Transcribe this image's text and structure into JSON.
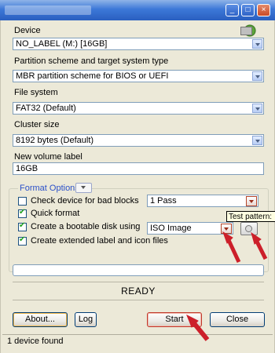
{
  "device": {
    "label": "Device",
    "value": "NO_LABEL (M:) [16GB]"
  },
  "partition": {
    "label": "Partition scheme and target system type",
    "value": "MBR partition scheme for BIOS or UEFI"
  },
  "filesystem": {
    "label": "File system",
    "value": "FAT32 (Default)"
  },
  "cluster": {
    "label": "Cluster size",
    "value": "8192 bytes (Default)"
  },
  "volume": {
    "label": "New volume label",
    "value": "16GB"
  },
  "format_options": {
    "title": "Format Options",
    "bad_blocks": {
      "label": "Check device for bad blocks",
      "checked": false,
      "passes": "1 Pass"
    },
    "quick_format": {
      "label": "Quick format",
      "checked": true
    },
    "bootable": {
      "label": "Create a bootable disk using",
      "checked": true,
      "source": "ISO Image"
    },
    "extended_label": {
      "label": "Create extended label and icon files",
      "checked": true
    }
  },
  "tooltip": "Test pattern:",
  "status": "READY",
  "buttons": {
    "about": "About...",
    "log": "Log",
    "start": "Start",
    "close": "Close"
  },
  "statusbar": "1 device found",
  "icons": [
    "device-drive-icon",
    "dropdown-icon",
    "check-icon",
    "disk-image-icon",
    "red-arrow-annotation"
  ],
  "colors": {
    "dialog_bg": "#ece9d8",
    "title_blue": "#2b50c9",
    "annotation_red": "#cc1f2a",
    "check_green": "#21a121"
  }
}
